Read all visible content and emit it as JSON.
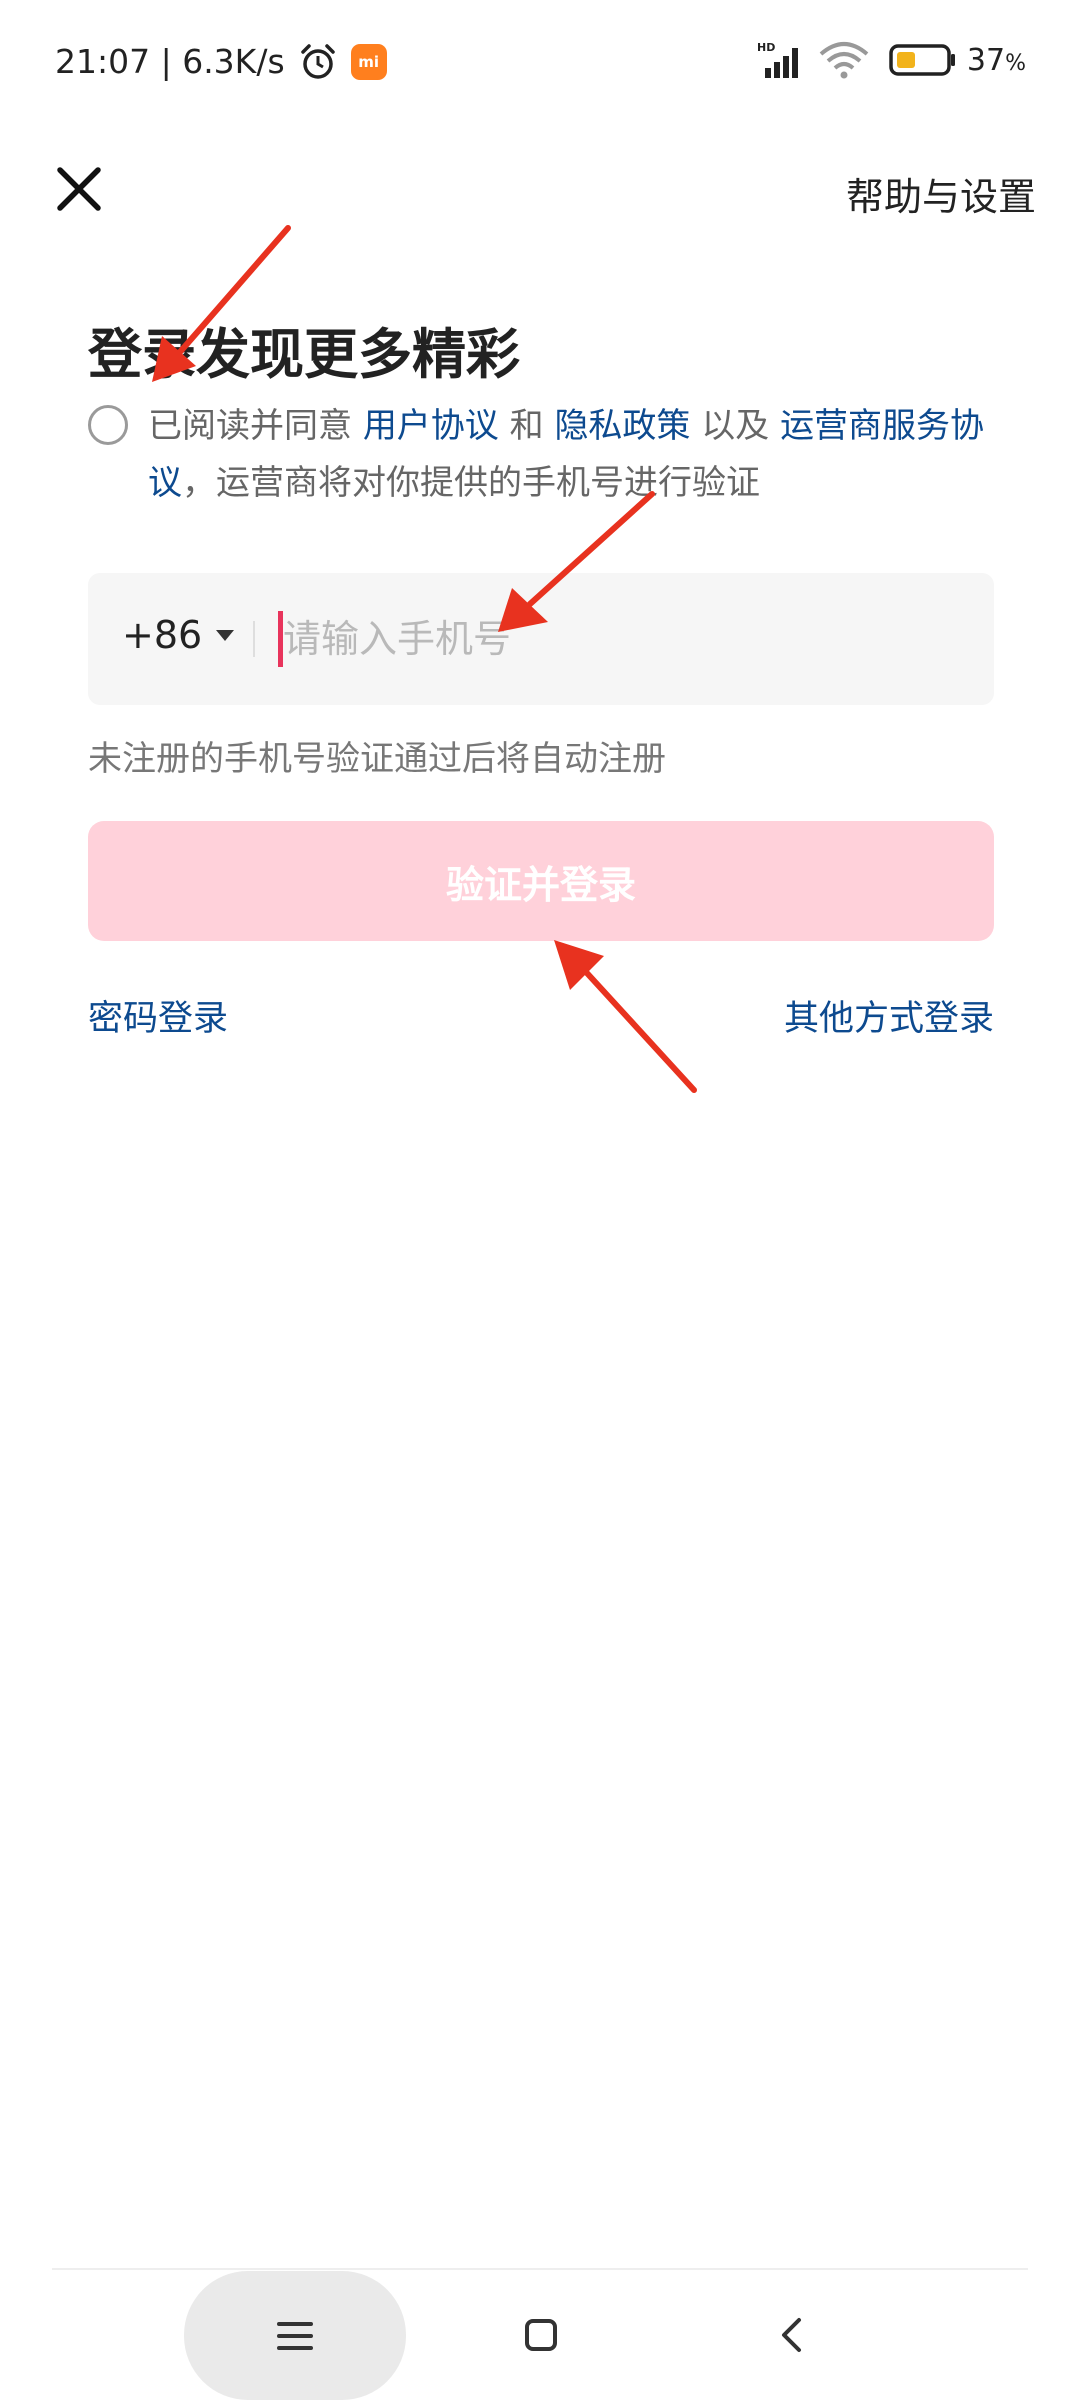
{
  "status_bar": {
    "time_speed": "21:07 | 6.3K/s",
    "mi_badge": "mi",
    "network_label": "HD",
    "battery_percent": "37",
    "battery_unit": "%"
  },
  "header": {
    "close_icon": "close-icon",
    "help_link": "帮助与设置"
  },
  "main": {
    "title": "登录发现更多精彩",
    "agreement": {
      "prefix": "已阅读并同意 ",
      "link_user": "用户协议",
      "and": " 和 ",
      "link_privacy": "隐私政策",
      "also": " 以及 ",
      "link_carrier": "运营商服务协议",
      "suffix": "，运营商将对你提供的手机号进行验证"
    },
    "phone": {
      "country_code": "+86",
      "placeholder": "请输入手机号",
      "value": ""
    },
    "hint": "未注册的手机号验证通过后将自动注册",
    "login_button": "验证并登录",
    "password_login": "密码登录",
    "other_login": "其他方式登录"
  },
  "nav": {
    "menu_icon": "menu-icon",
    "home_icon": "home-icon",
    "back_icon": "back-icon"
  },
  "colors": {
    "link": "#0d4a8f",
    "button_disabled": "#ffd1da",
    "cursor": "#e8345c",
    "annotation_arrow": "#e8321f"
  }
}
